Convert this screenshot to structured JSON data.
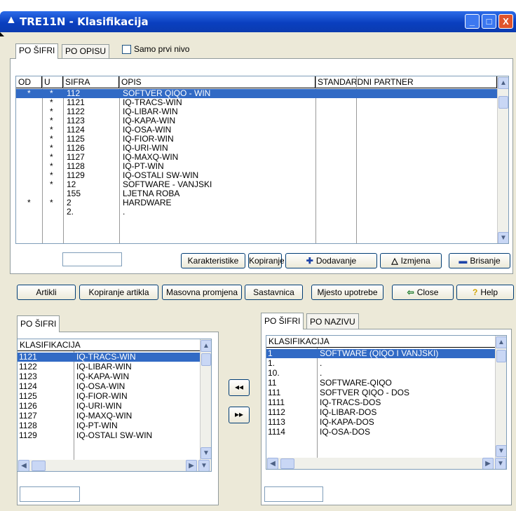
{
  "window": {
    "title": "TRE11N - Klasifikacija",
    "min": "_",
    "max": "□",
    "close": "X"
  },
  "top_tabs": {
    "tab1": "PO ŠIFRI",
    "tab2": "PO OPISU",
    "checkbox_label": "Samo prvi nivo"
  },
  "main_grid": {
    "headers": [
      "OD",
      "U",
      "SIFRA",
      "OPIS",
      "STANDARDNI PARTNER"
    ],
    "rows": [
      {
        "od": "*",
        "u": "*",
        "sifra": "112",
        "opis": "SOFTVER QIQO - WIN"
      },
      {
        "od": "",
        "u": "*",
        "sifra": "1121",
        "opis": "IQ-TRACS-WIN"
      },
      {
        "od": "",
        "u": "*",
        "sifra": "1122",
        "opis": "IQ-LIBAR-WIN"
      },
      {
        "od": "",
        "u": "*",
        "sifra": "1123",
        "opis": "IQ-KAPA-WIN"
      },
      {
        "od": "",
        "u": "*",
        "sifra": "1124",
        "opis": "IQ-OSA-WIN"
      },
      {
        "od": "",
        "u": "*",
        "sifra": "1125",
        "opis": "IQ-FIOR-WIN"
      },
      {
        "od": "",
        "u": "*",
        "sifra": "1126",
        "opis": "IQ-URI-WIN"
      },
      {
        "od": "",
        "u": "*",
        "sifra": "1127",
        "opis": "IQ-MAXQ-WIN"
      },
      {
        "od": "",
        "u": "*",
        "sifra": "1128",
        "opis": "IQ-PT-WIN"
      },
      {
        "od": "",
        "u": "*",
        "sifra": "1129",
        "opis": "IQ-OSTALI SW-WIN"
      },
      {
        "od": "",
        "u": "*",
        "sifra": "12",
        "opis": "SOFTWARE - VANJSKI"
      },
      {
        "od": "",
        "u": "",
        "sifra": "155",
        "opis": "LJETNA ROBA"
      },
      {
        "od": "*",
        "u": "*",
        "sifra": "2",
        "opis": "HARDWARE"
      },
      {
        "od": "",
        "u": "",
        "sifra": "2.",
        "opis": "."
      }
    ]
  },
  "row_buttons": {
    "karakteristike": "Karakteristike",
    "kopiranje": "Kopiranje",
    "dodavanje": "Dodavanje",
    "izmjena": "Izmjena",
    "brisanje": "Brisanje"
  },
  "toolbar": {
    "artikli": "Artikli",
    "kopiranje_artikla": "Kopiranje artikla",
    "masovna": "Masovna promjena",
    "sastavnica": "Sastavnica",
    "mjesto": "Mjesto upotrebe",
    "close": "Close",
    "help": "Help"
  },
  "left_list": {
    "tab": "PO ŠIFRI",
    "header": "KLASIFIKACIJA",
    "rows": [
      {
        "code": "1121",
        "name": "IQ-TRACS-WIN"
      },
      {
        "code": "1122",
        "name": "IQ-LIBAR-WIN"
      },
      {
        "code": "1123",
        "name": "IQ-KAPA-WIN"
      },
      {
        "code": "1124",
        "name": "IQ-OSA-WIN"
      },
      {
        "code": "1125",
        "name": "IQ-FIOR-WIN"
      },
      {
        "code": "1126",
        "name": "IQ-URI-WIN"
      },
      {
        "code": "1127",
        "name": "IQ-MAXQ-WIN"
      },
      {
        "code": "1128",
        "name": "IQ-PT-WIN"
      },
      {
        "code": "1129",
        "name": "IQ-OSTALI SW-WIN"
      }
    ]
  },
  "transfer": {
    "left": "◂◂",
    "right": "▸▸"
  },
  "right_list": {
    "tab1": "PO ŠIFRI",
    "tab2": "PO NAZIVU",
    "header": "KLASIFIKACIJA",
    "rows": [
      {
        "code": "1",
        "name": "SOFTWARE (QIQO I VANJSKI)"
      },
      {
        "code": "1.",
        "name": "."
      },
      {
        "code": "10.",
        "name": "."
      },
      {
        "code": "11",
        "name": "SOFTWARE-QIQO"
      },
      {
        "code": "111",
        "name": "SOFTVER QIQO - DOS"
      },
      {
        "code": "1111",
        "name": "IQ-TRACS-DOS"
      },
      {
        "code": "1112",
        "name": "IQ-LIBAR-DOS"
      },
      {
        "code": "1113",
        "name": "IQ-KAPA-DOS"
      },
      {
        "code": "1114",
        "name": "IQ-OSA-DOS"
      }
    ]
  },
  "colors": {
    "selection": "#316ac5",
    "titlebar": "#0a3fbf",
    "face": "#ece9d8"
  }
}
